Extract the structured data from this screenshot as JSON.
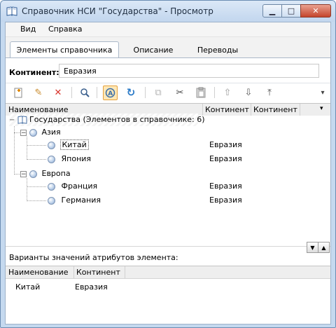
{
  "window": {
    "title": "Справочник НСИ \"Государства\" - Просмотр",
    "minimize_glyph": "▁",
    "maximize_glyph": "□",
    "close_glyph": "✕"
  },
  "menu": {
    "items": [
      "Вид",
      "Справка"
    ]
  },
  "tabs": [
    {
      "label": "Элементы справочника",
      "active": true
    },
    {
      "label": "Описание",
      "active": false
    },
    {
      "label": "Переводы",
      "active": false
    }
  ],
  "continent_field": {
    "label": "Континент:",
    "value": "Евразия"
  },
  "toolbar": {
    "icons": [
      "add-element-icon",
      "edit-icon",
      "delete-icon",
      "find-icon",
      "attribute-filter-icon",
      "refresh-icon",
      "copy-icon",
      "cut-icon",
      "paste-icon",
      "move-up-icon",
      "move-down-icon",
      "move-top-icon",
      "dropdown-icon"
    ],
    "glyphs": {
      "add": "✚",
      "edit": "✎",
      "delete": "✕",
      "find": "⚲",
      "filter": "A",
      "refresh": "↻",
      "copy": "⧉",
      "cut": "✂",
      "paste": "📋",
      "up": "⇧",
      "down": "⇩",
      "top": "⤒",
      "more": "▾"
    }
  },
  "grid": {
    "columns": [
      "Наименование",
      "Континент",
      "Континент"
    ],
    "dropdown_glyph": "▾",
    "root": "Государства (Элементов в справочнике: 6)",
    "groups": [
      {
        "name": "Азия",
        "items": [
          {
            "name": "Китай",
            "continent": "Евразия"
          },
          {
            "name": "Япония",
            "continent": "Евразия"
          }
        ]
      },
      {
        "name": "Европа",
        "items": [
          {
            "name": "Франция",
            "continent": "Евразия"
          },
          {
            "name": "Германия",
            "continent": "Евразия"
          }
        ]
      }
    ],
    "expander_glyph": "−"
  },
  "variants": {
    "label": "Варианты значений атрибутов элемента:",
    "columns": [
      "Наименование",
      "Континент"
    ],
    "rows": [
      {
        "name": "Китай",
        "continent": "Евразия"
      }
    ],
    "down_glyph": "▼",
    "up_glyph": "▲"
  },
  "colors": {
    "window_frame": "#6b8db3",
    "close_button": "#c4452c",
    "active_tool_border": "#e5a13c",
    "toolbar_red": "#d9342b"
  }
}
